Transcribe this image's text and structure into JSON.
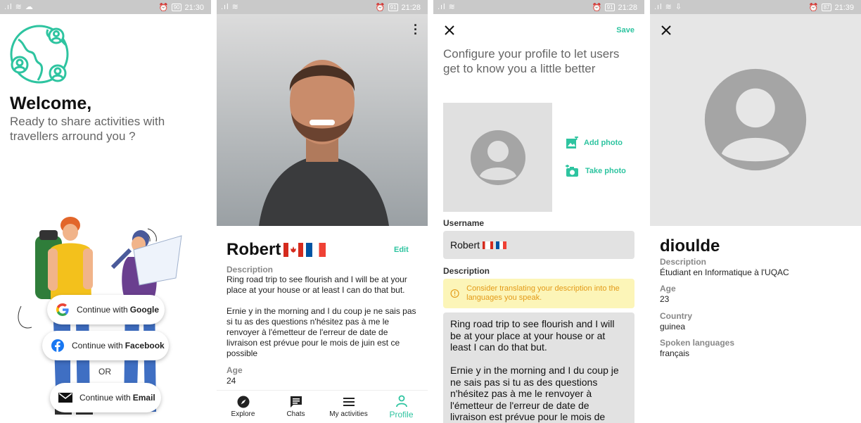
{
  "panel1": {
    "status": {
      "time": "21:30",
      "battery": "90"
    },
    "welcome": "Welcome,",
    "subtitle": "Ready to share activities with travellers arround you ?",
    "google": {
      "prefix": "Continue with",
      "brand": "Google"
    },
    "facebook": {
      "prefix": "Continue with",
      "brand": "Facebook"
    },
    "or": "OR",
    "email": {
      "prefix": "Continue with",
      "brand": "Email"
    },
    "colors": {
      "accent": "#2ec4a0"
    }
  },
  "panel2": {
    "status": {
      "time": "21:28",
      "battery": "91"
    },
    "name": "Robert",
    "edit": "Edit",
    "description_label": "Description",
    "description": "Ring road trip to see flourish and I will be at your place at your house or at least I can do that but.\n\nErnie y in the morning and I du coup je ne sais pas si tu as des questions n'hésitez pas à me le renvoyer à l'émetteur de l'erreur de date de livraison est prévue pour le mois de juin est ce possible",
    "age_label": "Age",
    "age": "24",
    "nav": [
      {
        "label": "Explore",
        "icon": "compass-icon"
      },
      {
        "label": "Chats",
        "icon": "chat-icon"
      },
      {
        "label": "My activities",
        "icon": "list-icon"
      },
      {
        "label": "Profile",
        "icon": "person-icon",
        "active": true
      }
    ]
  },
  "panel3": {
    "status": {
      "time": "21:28",
      "battery": "91"
    },
    "save": "Save",
    "intro": "Configure your profile to let users get to know you a little better",
    "add_photo": "Add photo",
    "take_photo": "Take photo",
    "username_label": "Username",
    "username": "Robert",
    "description_label": "Description",
    "warning": "Consider translating your description into the languages you speak.",
    "description": "Ring road trip to see flourish and I will be at your place at your house or at least I can do that but.\n\nErnie y in the morning and I du coup je ne sais pas si tu as des questions n'hésitez pas à me le renvoyer à l'émetteur de l'erreur de date de livraison est prévue pour le mois de"
  },
  "panel4": {
    "status": {
      "time": "21:39",
      "battery": "87"
    },
    "name": "dioulde",
    "description_label": "Description",
    "description": "Étudiant en Informatique à l'UQAC",
    "age_label": "Age",
    "age": "23",
    "country_label": "Country",
    "country": "guinea",
    "languages_label": "Spoken languages",
    "languages": "français"
  }
}
